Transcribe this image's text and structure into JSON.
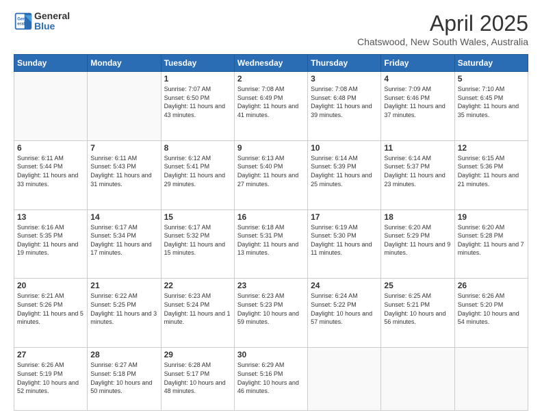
{
  "header": {
    "logo_line1": "General",
    "logo_line2": "Blue",
    "month": "April 2025",
    "location": "Chatswood, New South Wales, Australia"
  },
  "days_of_week": [
    "Sunday",
    "Monday",
    "Tuesday",
    "Wednesday",
    "Thursday",
    "Friday",
    "Saturday"
  ],
  "weeks": [
    [
      {
        "day": "",
        "info": ""
      },
      {
        "day": "",
        "info": ""
      },
      {
        "day": "1",
        "info": "Sunrise: 7:07 AM\nSunset: 6:50 PM\nDaylight: 11 hours and 43 minutes."
      },
      {
        "day": "2",
        "info": "Sunrise: 7:08 AM\nSunset: 6:49 PM\nDaylight: 11 hours and 41 minutes."
      },
      {
        "day": "3",
        "info": "Sunrise: 7:08 AM\nSunset: 6:48 PM\nDaylight: 11 hours and 39 minutes."
      },
      {
        "day": "4",
        "info": "Sunrise: 7:09 AM\nSunset: 6:46 PM\nDaylight: 11 hours and 37 minutes."
      },
      {
        "day": "5",
        "info": "Sunrise: 7:10 AM\nSunset: 6:45 PM\nDaylight: 11 hours and 35 minutes."
      }
    ],
    [
      {
        "day": "6",
        "info": "Sunrise: 6:11 AM\nSunset: 5:44 PM\nDaylight: 11 hours and 33 minutes."
      },
      {
        "day": "7",
        "info": "Sunrise: 6:11 AM\nSunset: 5:43 PM\nDaylight: 11 hours and 31 minutes."
      },
      {
        "day": "8",
        "info": "Sunrise: 6:12 AM\nSunset: 5:41 PM\nDaylight: 11 hours and 29 minutes."
      },
      {
        "day": "9",
        "info": "Sunrise: 6:13 AM\nSunset: 5:40 PM\nDaylight: 11 hours and 27 minutes."
      },
      {
        "day": "10",
        "info": "Sunrise: 6:14 AM\nSunset: 5:39 PM\nDaylight: 11 hours and 25 minutes."
      },
      {
        "day": "11",
        "info": "Sunrise: 6:14 AM\nSunset: 5:37 PM\nDaylight: 11 hours and 23 minutes."
      },
      {
        "day": "12",
        "info": "Sunrise: 6:15 AM\nSunset: 5:36 PM\nDaylight: 11 hours and 21 minutes."
      }
    ],
    [
      {
        "day": "13",
        "info": "Sunrise: 6:16 AM\nSunset: 5:35 PM\nDaylight: 11 hours and 19 minutes."
      },
      {
        "day": "14",
        "info": "Sunrise: 6:17 AM\nSunset: 5:34 PM\nDaylight: 11 hours and 17 minutes."
      },
      {
        "day": "15",
        "info": "Sunrise: 6:17 AM\nSunset: 5:32 PM\nDaylight: 11 hours and 15 minutes."
      },
      {
        "day": "16",
        "info": "Sunrise: 6:18 AM\nSunset: 5:31 PM\nDaylight: 11 hours and 13 minutes."
      },
      {
        "day": "17",
        "info": "Sunrise: 6:19 AM\nSunset: 5:30 PM\nDaylight: 11 hours and 11 minutes."
      },
      {
        "day": "18",
        "info": "Sunrise: 6:20 AM\nSunset: 5:29 PM\nDaylight: 11 hours and 9 minutes."
      },
      {
        "day": "19",
        "info": "Sunrise: 6:20 AM\nSunset: 5:28 PM\nDaylight: 11 hours and 7 minutes."
      }
    ],
    [
      {
        "day": "20",
        "info": "Sunrise: 6:21 AM\nSunset: 5:26 PM\nDaylight: 11 hours and 5 minutes."
      },
      {
        "day": "21",
        "info": "Sunrise: 6:22 AM\nSunset: 5:25 PM\nDaylight: 11 hours and 3 minutes."
      },
      {
        "day": "22",
        "info": "Sunrise: 6:23 AM\nSunset: 5:24 PM\nDaylight: 11 hours and 1 minute."
      },
      {
        "day": "23",
        "info": "Sunrise: 6:23 AM\nSunset: 5:23 PM\nDaylight: 10 hours and 59 minutes."
      },
      {
        "day": "24",
        "info": "Sunrise: 6:24 AM\nSunset: 5:22 PM\nDaylight: 10 hours and 57 minutes."
      },
      {
        "day": "25",
        "info": "Sunrise: 6:25 AM\nSunset: 5:21 PM\nDaylight: 10 hours and 56 minutes."
      },
      {
        "day": "26",
        "info": "Sunrise: 6:26 AM\nSunset: 5:20 PM\nDaylight: 10 hours and 54 minutes."
      }
    ],
    [
      {
        "day": "27",
        "info": "Sunrise: 6:26 AM\nSunset: 5:19 PM\nDaylight: 10 hours and 52 minutes."
      },
      {
        "day": "28",
        "info": "Sunrise: 6:27 AM\nSunset: 5:18 PM\nDaylight: 10 hours and 50 minutes."
      },
      {
        "day": "29",
        "info": "Sunrise: 6:28 AM\nSunset: 5:17 PM\nDaylight: 10 hours and 48 minutes."
      },
      {
        "day": "30",
        "info": "Sunrise: 6:29 AM\nSunset: 5:16 PM\nDaylight: 10 hours and 46 minutes."
      },
      {
        "day": "",
        "info": ""
      },
      {
        "day": "",
        "info": ""
      },
      {
        "day": "",
        "info": ""
      }
    ]
  ]
}
